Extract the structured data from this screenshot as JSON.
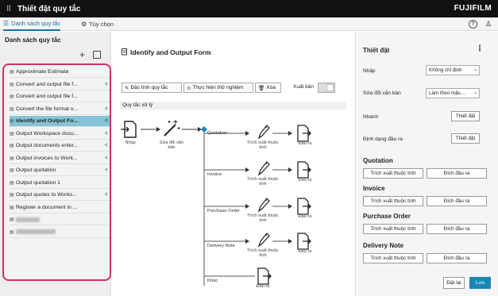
{
  "window": {
    "title": "Thiết đặt quy tắc",
    "brand": "FUJIFILM"
  },
  "tabs": [
    {
      "label": "Danh sách quy tắc"
    },
    {
      "label": "Tùy chọn"
    }
  ],
  "left": {
    "heading": "Danh sách quy tắc",
    "rules": [
      {
        "label": "Approximate Estimate",
        "shared": false
      },
      {
        "label": "Convert and output file f...",
        "shared": true
      },
      {
        "label": "Convert and output file f...",
        "shared": false
      },
      {
        "label": "Convert the file format o...",
        "shared": true
      },
      {
        "label": "Identify and Output Fo...",
        "shared": true
      },
      {
        "label": "Output Workspace docu...",
        "shared": true
      },
      {
        "label": "Output documents enter...",
        "shared": true
      },
      {
        "label": "Output invoices to Work...",
        "shared": true
      },
      {
        "label": "Output quotation",
        "shared": true
      },
      {
        "label": "Output quotation 1",
        "shared": false
      },
      {
        "label": "Output quotes to Works...",
        "shared": true
      },
      {
        "label": "Register a document in ...",
        "shared": false
      },
      {
        "label": "",
        "shared": false
      },
      {
        "label": "",
        "shared": false
      }
    ]
  },
  "center": {
    "form_title": "Identify and Output Form",
    "toolbar": {
      "properties": "Đặc tính quy tắc",
      "test": "Thực hiện thử nghiệm",
      "delete": "Xóa",
      "publish_label": "Xuất bản"
    },
    "rules_label": "Quy tắc xử lý",
    "flow": {
      "input": "Nhập",
      "convert": "Sửa đổi văn bản",
      "extract": "Trích xuất thuộc tính",
      "output": "Đầu ra",
      "branches": [
        "Quotation",
        "Invoice",
        "Purchase Order",
        "Delivery Note",
        "Khác"
      ]
    }
  },
  "right": {
    "heading": "Thiết đặt",
    "fields": [
      {
        "label": "Nhập",
        "value": "Không chỉ định"
      },
      {
        "label": "Sửa đổi văn bản",
        "value": "Làm theo mặc..."
      }
    ],
    "branch_label": "Nhánh",
    "format_label": "Định dạng đầu ra",
    "settings_button": "Thiết đặt",
    "sections": [
      "Quotation",
      "Invoice",
      "Purchase Order",
      "Delivery Note"
    ],
    "extract_button": "Trích xuất thuộc tính",
    "dest_button": "Đích đầu ra",
    "reset": "Đặt lại",
    "save": "Lưu"
  },
  "colors": {
    "accent": "#1a86b5",
    "highlight": "#86c3d6",
    "annotation": "#c8336b",
    "diamond": "#1a86b5"
  }
}
